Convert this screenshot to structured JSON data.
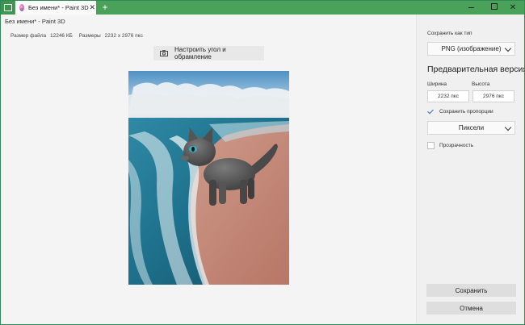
{
  "titlebar": {
    "tab_title": "Без имени* - Paint 3D",
    "tab_close": "✕",
    "new_tab": "+",
    "accent_color": "#4aa25a"
  },
  "app": {
    "title": "Без имени* - Paint 3D"
  },
  "fileinfo": {
    "size_label": "Размер файла",
    "size_value": "12246 КБ",
    "dims_label": "Размеры",
    "dims_value": "2232 x 2976 пкс"
  },
  "toolbar": {
    "adjust_label": "Настроить угол и обрамление"
  },
  "panel": {
    "save_as_type_label": "Сохранить как тип",
    "save_as_type_value": "PNG (изображение)",
    "preview_heading": "Предварительная версия",
    "width_label": "Ширина",
    "height_label": "Высота",
    "width_value": "2232 пкс",
    "height_value": "2976 пкс",
    "keep_ratio_label": "Сохранить пропорции",
    "keep_ratio_checked": true,
    "units_value": "Пиксели",
    "transparency_label": "Прозрачность",
    "transparency_checked": false,
    "save_button": "Сохранить",
    "cancel_button": "Отмена"
  },
  "canvas": {
    "description_icons": [
      "sky",
      "sea",
      "beach",
      "cat-model"
    ]
  }
}
